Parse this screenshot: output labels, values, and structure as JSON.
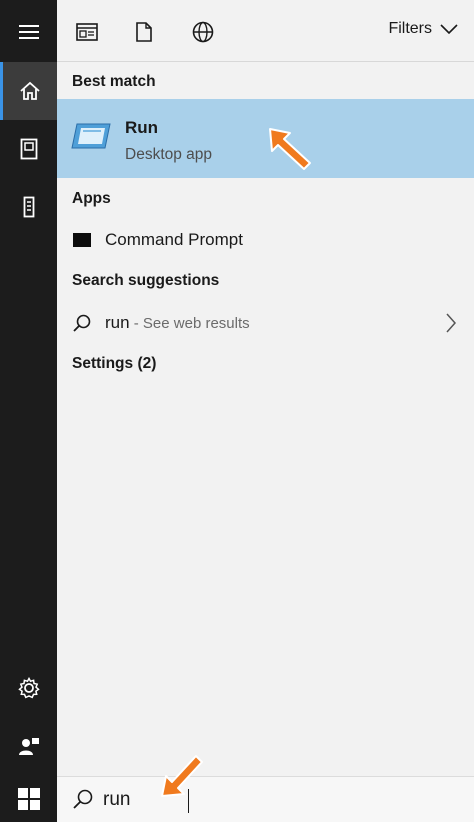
{
  "rail": {
    "items": [
      {
        "icon": "hamburger-menu-icon"
      },
      {
        "icon": "home-icon",
        "active": true
      },
      {
        "icon": "documents-icon"
      },
      {
        "icon": "device-icon"
      },
      {
        "icon": "settings-gear-icon"
      },
      {
        "icon": "user-feedback-icon"
      },
      {
        "icon": "windows-start-icon"
      }
    ]
  },
  "toolbar": {
    "icons": [
      "apps-filter-icon",
      "document-filter-icon",
      "web-filter-icon"
    ],
    "filters_label": "Filters"
  },
  "results": {
    "best_match_header": "Best match",
    "best_match": {
      "title": "Run",
      "subtitle": "Desktop app",
      "icon": "run-dialog-icon"
    },
    "apps_header": "Apps",
    "apps": [
      {
        "label": "Command Prompt",
        "icon": "command-prompt-icon"
      }
    ],
    "suggestions_header": "Search suggestions",
    "suggestions": [
      {
        "query": "run",
        "hint": " - See web results"
      }
    ],
    "settings_header": "Settings (2)"
  },
  "search": {
    "value": "run",
    "placeholder": ""
  },
  "colors": {
    "highlight": "#a9d0ea",
    "accent": "#3a93e6",
    "annotation_arrow": "#f07a1e",
    "rail": "#1c1c1c"
  }
}
